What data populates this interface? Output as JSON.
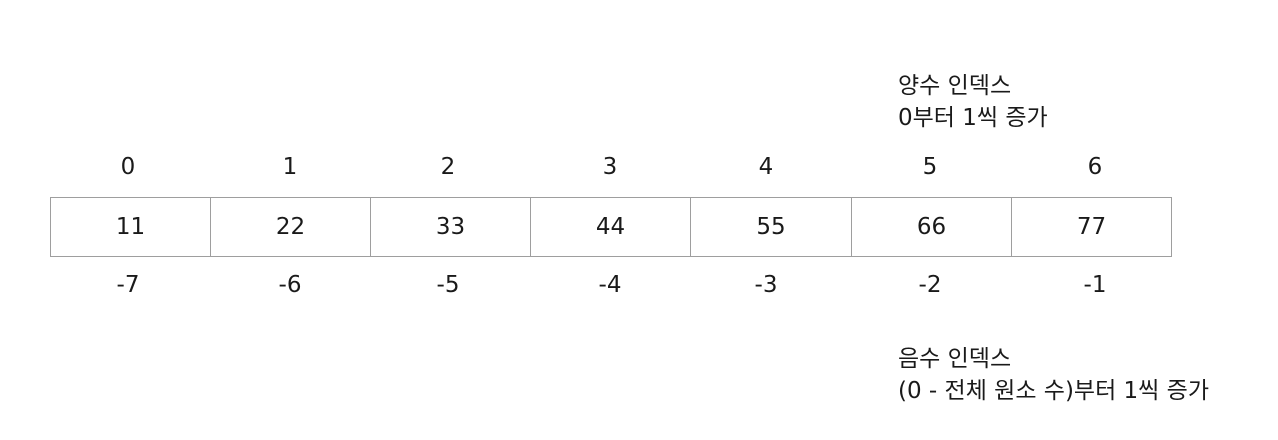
{
  "positive_note": {
    "line1": "양수 인덱스",
    "line2": "0부터 1씩 증가"
  },
  "negative_note": {
    "line1": "음수 인덱스",
    "line2": "(0 - 전체 원소 수)부터 1씩 증가"
  },
  "positive_indices": [
    "0",
    "1",
    "2",
    "3",
    "4",
    "5",
    "6"
  ],
  "values": [
    "11",
    "22",
    "33",
    "44",
    "55",
    "66",
    "77"
  ],
  "negative_indices": [
    "-7",
    "-6",
    "-5",
    "-4",
    "-3",
    "-2",
    "-1"
  ],
  "colors": {
    "text": "#1a1a1a",
    "cell_border": "#9e9e9e",
    "background": "#ffffff"
  }
}
